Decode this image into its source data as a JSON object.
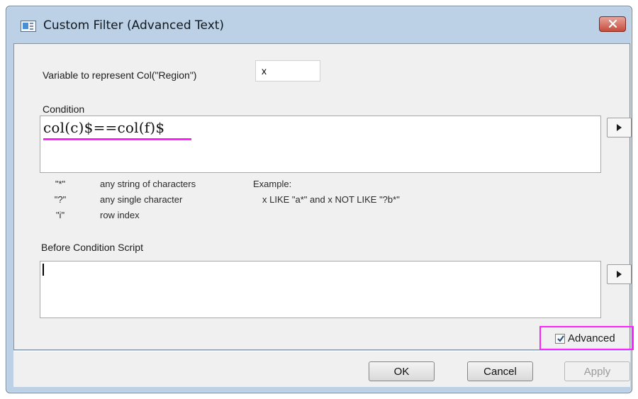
{
  "window": {
    "title": "Custom Filter (Advanced Text)",
    "close_icon": "close-icon"
  },
  "form": {
    "variable_label": "Variable to represent Col(\"Region\")",
    "variable_value": "x",
    "condition_label": "Condition",
    "condition_value": "col(c)$==col(f)$",
    "before_script_label": "Before Condition Script",
    "before_script_value": ""
  },
  "hints": [
    {
      "key": "\"*\"",
      "desc": "any string of characters"
    },
    {
      "key": "\"?\"",
      "desc": "any single character"
    },
    {
      "key": "\"i\"",
      "desc": "row index"
    }
  ],
  "example": {
    "label": "Example:",
    "text": "x LIKE \"a*\" and x NOT LIKE \"?b*\""
  },
  "advanced": {
    "label": "Advanced",
    "checked": true
  },
  "buttons": {
    "ok": "OK",
    "cancel": "Cancel",
    "apply": "Apply"
  },
  "colors": {
    "title_bar": "#bcd1e6",
    "panel": "#f0f0f0",
    "highlight": "#ff21ff",
    "close_button": "#c84c3b"
  }
}
